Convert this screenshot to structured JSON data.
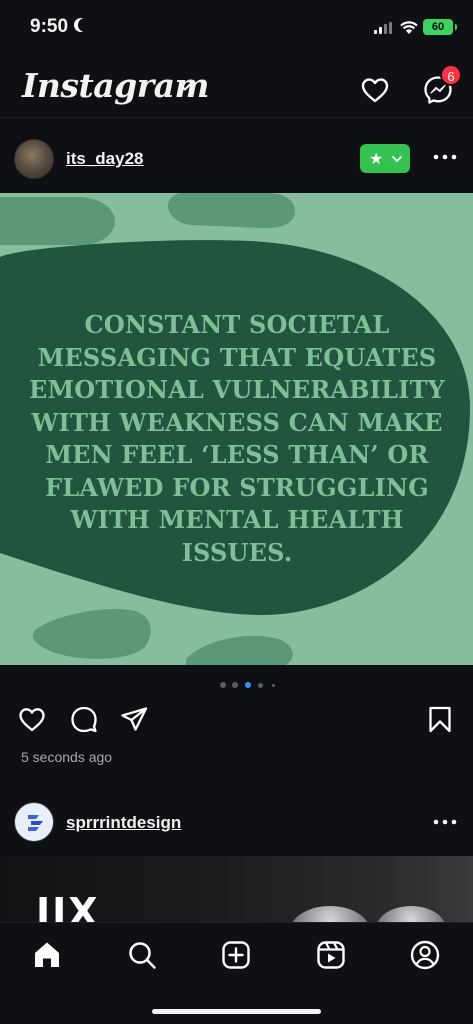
{
  "status_bar": {
    "time": "9:50",
    "battery": "60"
  },
  "header": {
    "app_name": "Instagram",
    "message_badge": "6"
  },
  "post1": {
    "username": "its_day28",
    "quote": "CONSTANT SOCIETAL MESSAGING THAT EQUATES EMOTIONAL VULNERABILITY WITH WEAKNESS CAN MAKE MEN FEEL ‘LESS THAN’ OR FLAWED FOR STRUGGLING WITH MENTAL HEALTH ISSUES.",
    "carousel": {
      "count": 5,
      "active": 3
    },
    "time_ago": "5 seconds ago"
  },
  "post2": {
    "username": "sprrrintdesign",
    "image_text": "IIX"
  },
  "colors": {
    "accent_green": "#33c24f",
    "badge_red": "#ff3040",
    "carousel_active": "#3f8ef5"
  },
  "icons": [
    "moon-icon",
    "signal-icon",
    "wifi-icon",
    "chevron-down-icon",
    "heart-icon",
    "messenger-icon",
    "star-icon",
    "more-icon",
    "comment-icon",
    "share-icon",
    "bookmark-icon",
    "home-icon",
    "search-icon",
    "create-icon",
    "reels-icon",
    "profile-icon"
  ]
}
